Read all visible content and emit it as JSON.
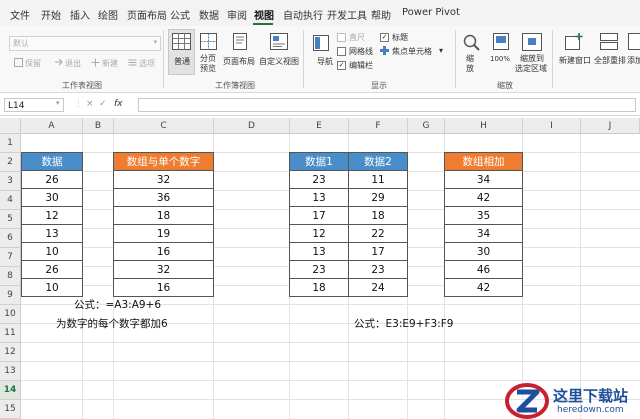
{
  "menu": {
    "items": [
      "文件",
      "开始",
      "插入",
      "绘图",
      "页面布局",
      "公式",
      "数据",
      "审阅",
      "视图",
      "自动执行",
      "开发工具",
      "帮助",
      "Power Pivot"
    ],
    "active_index": 8
  },
  "ribbon": {
    "sheet_view": {
      "combo_value": "默认",
      "keep": "保留",
      "exit": "退出",
      "new": "新建",
      "options": "选项",
      "label": "工作表视图"
    },
    "workbook_view": {
      "normal": "普通",
      "page_break_1": "分页",
      "page_break_2": "预览",
      "page_layout": "页面布局",
      "custom_views": "自定义视图",
      "label": "工作簿视图"
    },
    "show": {
      "navigation": "导航",
      "ruler": "直尺",
      "gridlines": "网格线",
      "formula_bar": "编辑栏",
      "headings": "标题",
      "focus_cell": "焦点单元格",
      "label": "显示"
    },
    "zoom": {
      "zoom": "缩放",
      "hundred": "100%",
      "to_selection_1": "缩放到",
      "to_selection_2": "选定区域",
      "label": "缩放"
    },
    "window": {
      "new_window": "新建窗口",
      "arrange_all": "全部重排",
      "add": "添加"
    },
    "accent": "#217346"
  },
  "formula_bar": {
    "name_box": "L14",
    "cancel": "×",
    "enter": "✓",
    "fx": "fx",
    "value": ""
  },
  "columns": [
    "A",
    "B",
    "C",
    "D",
    "E",
    "F",
    "G",
    "H",
    "I",
    "J"
  ],
  "rows": [
    "1",
    "2",
    "3",
    "4",
    "5",
    "6",
    "7",
    "8",
    "9",
    "10",
    "11",
    "12",
    "13",
    "14",
    "15"
  ],
  "table_a": {
    "header": "数据",
    "values": [
      "26",
      "30",
      "12",
      "13",
      "10",
      "26",
      "10"
    ]
  },
  "table_c": {
    "header": "数组与单个数字",
    "values": [
      "32",
      "36",
      "18",
      "19",
      "16",
      "32",
      "16"
    ]
  },
  "table_ef": {
    "headers": [
      "数据1",
      "数据2"
    ],
    "rows": [
      [
        "23",
        "11"
      ],
      [
        "13",
        "29"
      ],
      [
        "17",
        "18"
      ],
      [
        "12",
        "22"
      ],
      [
        "13",
        "17"
      ],
      [
        "23",
        "23"
      ],
      [
        "18",
        "24"
      ]
    ]
  },
  "table_h": {
    "header": "数组相加",
    "values": [
      "34",
      "42",
      "35",
      "34",
      "30",
      "46",
      "42"
    ]
  },
  "notes": {
    "formula_1": "公式：=A3:A9+6",
    "desc_1": "为数字的每个数字都加6",
    "formula_2": "公式：E3:E9+F3:F9"
  },
  "watermark": {
    "title": "这里下载站",
    "url": "heredown.com"
  },
  "colors": {
    "header_blue": "#4a8ec9",
    "header_orange": "#ee7d31",
    "logo_red": "#c8202c",
    "logo_blue": "#1f4e9c"
  }
}
